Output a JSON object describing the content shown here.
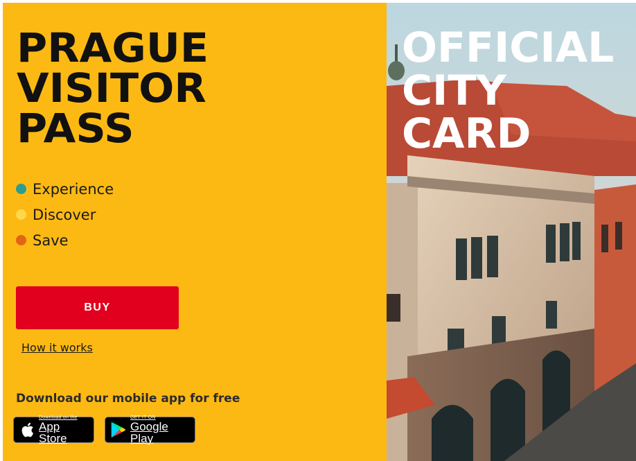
{
  "hero": {
    "title_lines": [
      "PRAGUE",
      "VISITOR",
      "PASS"
    ],
    "features": [
      {
        "label": "Experience",
        "color": "#2a9d8f"
      },
      {
        "label": "Discover",
        "color": "#ffd84a"
      },
      {
        "label": "Save",
        "color": "#e36414"
      }
    ],
    "buy_label": "BUY",
    "how_link": "How it works",
    "download_text": "Download our mobile app for free",
    "background_color": "#fdb913",
    "accent_color": "#e1001e"
  },
  "stores": {
    "apple": {
      "small": "Download on the",
      "big": "App Store",
      "icon": "apple-icon"
    },
    "google": {
      "small": "GET IT ON",
      "big": "Google Play",
      "icon": "google-play-icon"
    }
  },
  "card": {
    "title_lines": [
      "OFFICIAL",
      "CITY",
      "CARD"
    ],
    "image": "prague-old-town-hall-photo"
  }
}
